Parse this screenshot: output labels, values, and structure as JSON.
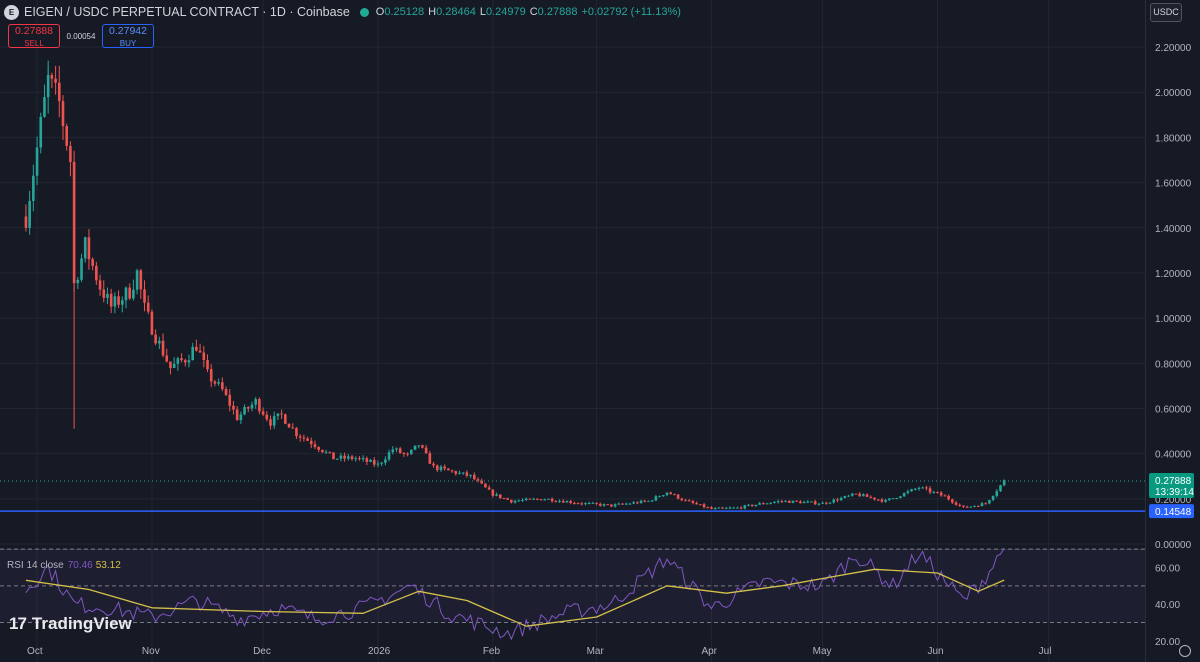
{
  "header": {
    "logo_text": "E",
    "symbol": "EIGEN / USDC PERPETUAL CONTRACT · 1D · Coinbase",
    "open_label": "O",
    "open": "0.25128",
    "high_label": "H",
    "high": "0.28464",
    "low_label": "L",
    "low": "0.24979",
    "close_label": "C",
    "close": "0.27888",
    "change": "+0.02792 (+11.13%)"
  },
  "trade": {
    "sell_price": "0.27888",
    "sell_label": "SELL",
    "spread": "0.00054",
    "buy_price": "0.27942",
    "buy_label": "BUY"
  },
  "currency": "USDC",
  "rsi": {
    "label": "RSI 14 close",
    "value": "70.46",
    "ma_value": "53.12"
  },
  "branding": {
    "mark": "17",
    "name": "TradingView"
  },
  "colors": {
    "up": "#26a69a",
    "down": "#ef5350",
    "line": "#2962ff",
    "rsi": "#7e57c2",
    "rsi_ma": "#d4c04a"
  },
  "chart_data": {
    "type": "candlestick",
    "x_ticks": [
      "Oct",
      "Nov",
      "Dec",
      "2026",
      "Feb",
      "Mar",
      "Apr",
      "May",
      "Jun",
      "Jul"
    ],
    "y_ticks": [
      "0.00000",
      "0.20000",
      "0.40000",
      "0.60000",
      "0.80000",
      "1.00000",
      "1.20000",
      "1.40000",
      "1.60000",
      "1.80000",
      "2.00000",
      "2.20000"
    ],
    "ylim": [
      0,
      2.24
    ],
    "last_price": 0.27888,
    "last_price_label": "0.27888",
    "countdown": "13:39:14",
    "horizontal_line": 0.14548,
    "horizontal_line_label": "0.14548",
    "close_path": [
      {
        "x": "2025-09-28",
        "y": 1.45
      },
      {
        "x": "2025-10-01",
        "y": 1.75
      },
      {
        "x": "2025-10-04",
        "y": 2.05
      },
      {
        "x": "2025-10-07",
        "y": 1.95
      },
      {
        "x": "2025-10-10",
        "y": 1.7
      },
      {
        "x": "2025-10-11",
        "y": 1.15
      },
      {
        "x": "2025-10-14",
        "y": 1.32
      },
      {
        "x": "2025-10-18",
        "y": 1.14
      },
      {
        "x": "2025-10-21",
        "y": 1.05
      },
      {
        "x": "2025-10-26",
        "y": 1.12
      },
      {
        "x": "2025-10-28",
        "y": 1.2
      },
      {
        "x": "2025-10-30",
        "y": 1.04
      },
      {
        "x": "2025-11-02",
        "y": 0.92
      },
      {
        "x": "2025-11-06",
        "y": 0.78
      },
      {
        "x": "2025-11-10",
        "y": 0.82
      },
      {
        "x": "2025-11-13",
        "y": 0.88
      },
      {
        "x": "2025-11-16",
        "y": 0.75
      },
      {
        "x": "2025-11-20",
        "y": 0.68
      },
      {
        "x": "2025-11-24",
        "y": 0.56
      },
      {
        "x": "2025-11-29",
        "y": 0.63
      },
      {
        "x": "2025-12-03",
        "y": 0.54
      },
      {
        "x": "2025-12-06",
        "y": 0.57
      },
      {
        "x": "2025-12-10",
        "y": 0.49
      },
      {
        "x": "2025-12-15",
        "y": 0.44
      },
      {
        "x": "2025-12-20",
        "y": 0.38
      },
      {
        "x": "2025-12-26",
        "y": 0.38
      },
      {
        "x": "2026-01-01",
        "y": 0.35
      },
      {
        "x": "2026-01-05",
        "y": 0.42
      },
      {
        "x": "2026-01-09",
        "y": 0.39
      },
      {
        "x": "2026-01-12",
        "y": 0.44
      },
      {
        "x": "2026-01-16",
        "y": 0.34
      },
      {
        "x": "2026-01-21",
        "y": 0.32
      },
      {
        "x": "2026-01-26",
        "y": 0.3
      },
      {
        "x": "2026-02-01",
        "y": 0.22
      },
      {
        "x": "2026-02-06",
        "y": 0.19
      },
      {
        "x": "2026-02-15",
        "y": 0.2
      },
      {
        "x": "2026-02-25",
        "y": 0.18
      },
      {
        "x": "2026-03-05",
        "y": 0.17
      },
      {
        "x": "2026-03-15",
        "y": 0.19
      },
      {
        "x": "2026-03-20",
        "y": 0.23
      },
      {
        "x": "2026-03-25",
        "y": 0.19
      },
      {
        "x": "2026-04-01",
        "y": 0.155
      },
      {
        "x": "2026-04-08",
        "y": 0.16
      },
      {
        "x": "2026-04-15",
        "y": 0.18
      },
      {
        "x": "2026-04-20",
        "y": 0.19
      },
      {
        "x": "2026-05-01",
        "y": 0.18
      },
      {
        "x": "2026-05-10",
        "y": 0.22
      },
      {
        "x": "2026-05-18",
        "y": 0.19
      },
      {
        "x": "2026-05-27",
        "y": 0.25
      },
      {
        "x": "2026-06-03",
        "y": 0.21
      },
      {
        "x": "2026-06-08",
        "y": 0.16
      },
      {
        "x": "2026-06-14",
        "y": 0.18
      },
      {
        "x": "2026-06-19",
        "y": 0.279
      }
    ],
    "spikes": [
      {
        "x": "2025-10-04",
        "high": 2.14
      },
      {
        "x": "2025-10-11",
        "low": 0.51
      }
    ],
    "rsi_panel": {
      "y_ticks": [
        "20.00",
        "40.00",
        "60.00"
      ],
      "ylim": [
        15,
        75
      ],
      "bands": [
        30,
        50,
        70
      ],
      "rsi_path": [
        {
          "x": "2025-09-28",
          "y": 48
        },
        {
          "x": "2025-10-04",
          "y": 60
        },
        {
          "x": "2025-10-11",
          "y": 40
        },
        {
          "x": "2025-10-20",
          "y": 38
        },
        {
          "x": "2025-11-01",
          "y": 33
        },
        {
          "x": "2025-11-13",
          "y": 42
        },
        {
          "x": "2025-11-25",
          "y": 32
        },
        {
          "x": "2025-12-05",
          "y": 38
        },
        {
          "x": "2025-12-15",
          "y": 32
        },
        {
          "x": "2025-12-28",
          "y": 38
        },
        {
          "x": "2026-01-10",
          "y": 50
        },
        {
          "x": "2026-01-20",
          "y": 35
        },
        {
          "x": "2026-02-05",
          "y": 24
        },
        {
          "x": "2026-02-20",
          "y": 35
        },
        {
          "x": "2026-03-05",
          "y": 40
        },
        {
          "x": "2026-03-20",
          "y": 65
        },
        {
          "x": "2026-04-01",
          "y": 38
        },
        {
          "x": "2026-04-15",
          "y": 52
        },
        {
          "x": "2026-05-01",
          "y": 50
        },
        {
          "x": "2026-05-10",
          "y": 67
        },
        {
          "x": "2026-05-20",
          "y": 50
        },
        {
          "x": "2026-05-27",
          "y": 68
        },
        {
          "x": "2026-06-08",
          "y": 42
        },
        {
          "x": "2026-06-14",
          "y": 55
        },
        {
          "x": "2026-06-19",
          "y": 70.46
        }
      ],
      "ma_path": [
        {
          "x": "2025-09-28",
          "y": 53
        },
        {
          "x": "2025-10-15",
          "y": 48
        },
        {
          "x": "2025-11-01",
          "y": 38
        },
        {
          "x": "2025-12-01",
          "y": 36
        },
        {
          "x": "2025-12-28",
          "y": 35
        },
        {
          "x": "2026-01-12",
          "y": 47
        },
        {
          "x": "2026-01-25",
          "y": 42
        },
        {
          "x": "2026-02-10",
          "y": 28
        },
        {
          "x": "2026-03-01",
          "y": 33
        },
        {
          "x": "2026-03-20",
          "y": 50
        },
        {
          "x": "2026-04-05",
          "y": 46
        },
        {
          "x": "2026-04-20",
          "y": 50
        },
        {
          "x": "2026-05-01",
          "y": 54
        },
        {
          "x": "2026-05-15",
          "y": 59
        },
        {
          "x": "2026-06-01",
          "y": 57
        },
        {
          "x": "2026-06-12",
          "y": 47
        },
        {
          "x": "2026-06-19",
          "y": 53.12
        }
      ]
    }
  }
}
